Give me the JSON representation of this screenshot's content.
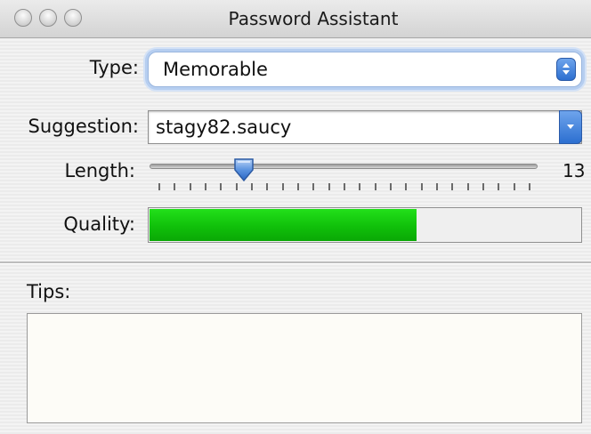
{
  "window": {
    "title": "Password Assistant",
    "traffic_lights": [
      "close",
      "minimize",
      "zoom"
    ]
  },
  "type": {
    "label": "Type:",
    "selected": "Memorable"
  },
  "suggestion": {
    "label": "Suggestion:",
    "value": "stagy82.saucy"
  },
  "length": {
    "label": "Length:",
    "value": "13",
    "slider_fraction": 0.23,
    "tick_count": 25
  },
  "quality": {
    "label": "Quality:",
    "fraction": 0.62,
    "color": "#12c40c"
  },
  "tips": {
    "label": "Tips:",
    "text": ""
  },
  "colors": {
    "accent": "#2c6fd0",
    "focus_ring": "#b6cef0"
  }
}
